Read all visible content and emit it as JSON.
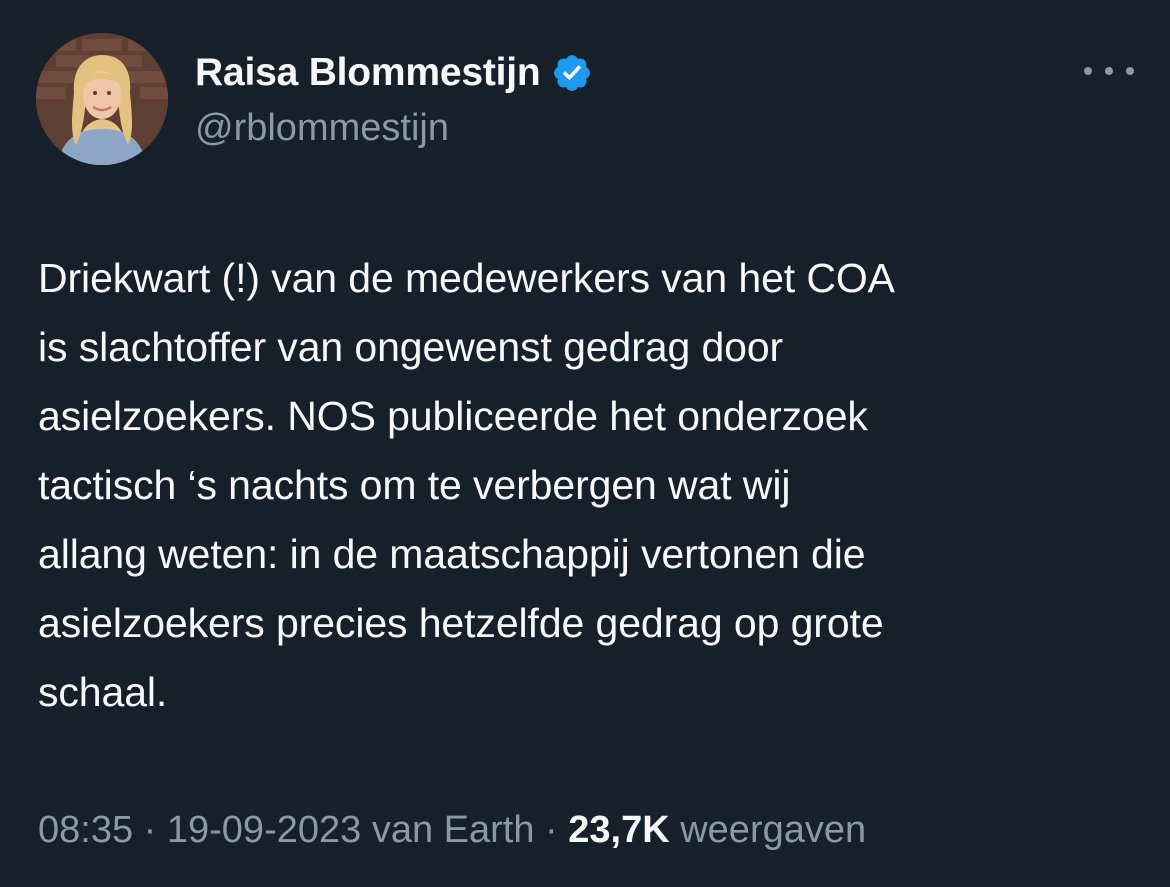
{
  "author": {
    "display_name": "Raisa Blommestijn",
    "handle": "@rblommestijn",
    "verified": true,
    "verified_color": "#1d9bf0"
  },
  "tweet": {
    "text_lines": [
      "Driekwart (!) van de medewerkers van het COA",
      "is slachtoffer van ongewenst gedrag door",
      "asielzoekers. NOS publiceerde het onderzoek",
      "tactisch ‘s nachts om te verbergen wat wij",
      "allang weten: in de maatschappij vertonen die",
      "asielzoekers precies hetzelfde gedrag op grote",
      "schaal."
    ]
  },
  "meta": {
    "time": "08:35",
    "separator": " · ",
    "date": "19-09-2023",
    "source": "van Earth",
    "views_count": "23,7K",
    "views_label": "weergaven"
  },
  "icons": {
    "more": "more-horizontal-icon",
    "verified": "verified-badge-icon"
  },
  "colors": {
    "background": "#15202b",
    "text_primary": "#f7f9f9",
    "text_secondary": "#8b98a5"
  }
}
